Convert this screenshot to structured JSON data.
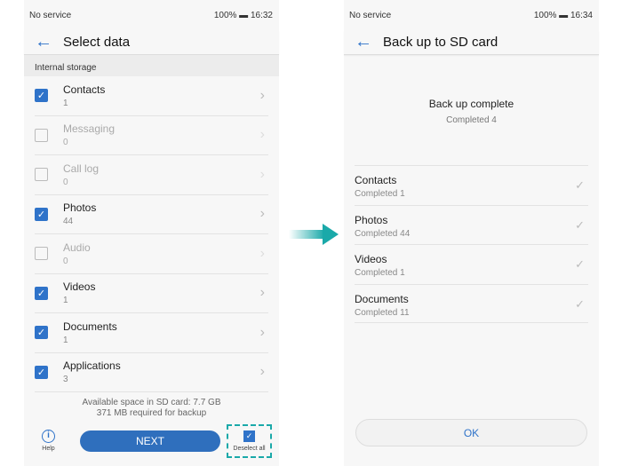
{
  "left": {
    "status": {
      "carrier": "No service",
      "battery": "100%",
      "time": "16:32"
    },
    "title": "Select data",
    "section": "Internal storage",
    "items": [
      {
        "name": "Contacts",
        "count": "1",
        "checked": true,
        "enabled": true
      },
      {
        "name": "Messaging",
        "count": "0",
        "checked": false,
        "enabled": false
      },
      {
        "name": "Call log",
        "count": "0",
        "checked": false,
        "enabled": false
      },
      {
        "name": "Photos",
        "count": "44",
        "checked": true,
        "enabled": true
      },
      {
        "name": "Audio",
        "count": "0",
        "checked": false,
        "enabled": false
      },
      {
        "name": "Videos",
        "count": "1",
        "checked": true,
        "enabled": true
      },
      {
        "name": "Documents",
        "count": "1",
        "checked": true,
        "enabled": true
      },
      {
        "name": "Applications",
        "count": "3",
        "checked": true,
        "enabled": true
      }
    ],
    "space": "Available space in SD card: 7.7 GB",
    "required": "371 MB required for backup",
    "help": "Help",
    "next": "NEXT",
    "deselect": "Deselect all"
  },
  "right": {
    "status": {
      "carrier": "No service",
      "battery": "100%",
      "time": "16:34"
    },
    "title": "Back up to SD card",
    "complete": "Back up complete",
    "completed": "Completed 4",
    "items": [
      {
        "name": "Contacts",
        "detail": "Completed 1"
      },
      {
        "name": "Photos",
        "detail": "Completed 44"
      },
      {
        "name": "Videos",
        "detail": "Completed 1"
      },
      {
        "name": "Documents",
        "detail": "Completed 11"
      }
    ],
    "ok": "OK"
  },
  "colors": {
    "accent": "#2f73c9",
    "arrow": "#1aa9a9"
  }
}
